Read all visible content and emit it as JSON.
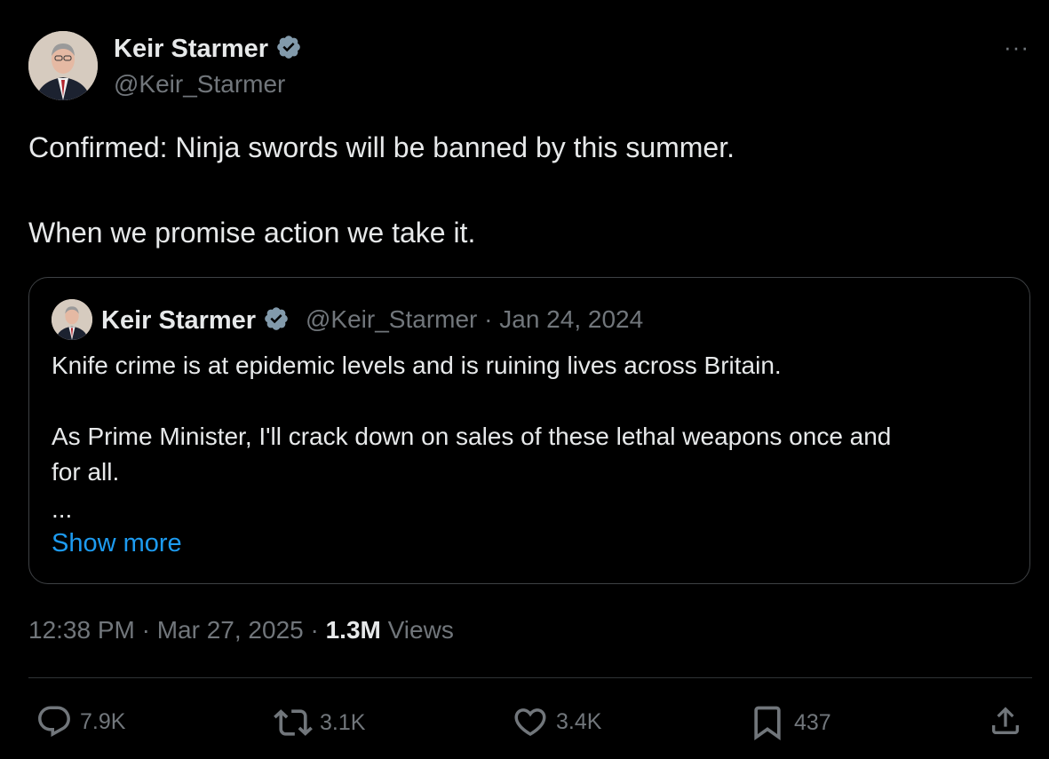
{
  "author": {
    "name": "Keir Starmer",
    "handle": "@Keir_Starmer"
  },
  "tweet": {
    "line1": "Confirmed: Ninja swords will be banned by this summer.",
    "line2": "When we promise action we take it."
  },
  "quoted": {
    "name": "Keir Starmer",
    "handle_date": "@Keir_Starmer · Jan 24, 2024",
    "line1": "Knife crime is at epidemic levels and is ruining lives across Britain.",
    "line2": "As Prime Minister, I'll crack down on sales of these lethal weapons once and",
    "line3": "for all.",
    "ellipsis": "...",
    "show_more": "Show more"
  },
  "meta": {
    "time_date": "12:38 PM · Mar 27, 2025 · ",
    "views_count": "1.3M",
    "views_label": " Views"
  },
  "actions": {
    "replies": "7.9K",
    "reposts": "3.1K",
    "likes": "3.4K",
    "bookmarks": "437"
  },
  "more_menu": "···",
  "colors": {
    "background": "#000000",
    "text": "#e7e9ea",
    "muted": "#71767b",
    "link": "#1d9bf0",
    "verified": "#829aab",
    "border": "#2f3336"
  }
}
